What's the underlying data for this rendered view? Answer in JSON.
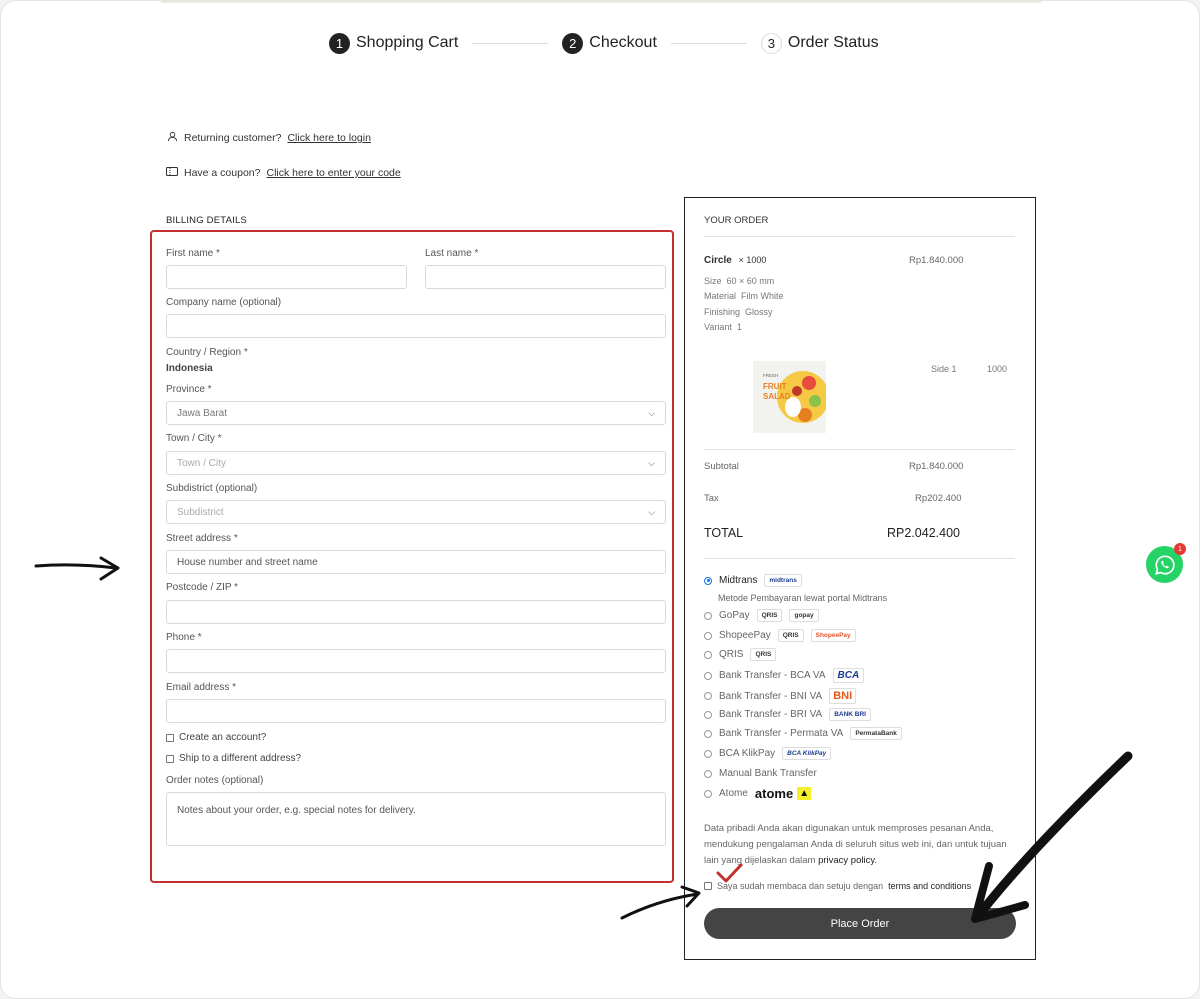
{
  "steps": [
    {
      "num": "1",
      "label": "Shopping Cart"
    },
    {
      "num": "2",
      "label": "Checkout"
    },
    {
      "num": "3",
      "label": "Order Status"
    }
  ],
  "notices": {
    "returning_text": "Returning customer?",
    "returning_link": "Click here to login",
    "coupon_text": "Have a coupon?",
    "coupon_link": "Click here to enter your code"
  },
  "billing": {
    "title": "BILLING DETAILS",
    "first_name_label": "First name *",
    "last_name_label": "Last name *",
    "company_label": "Company name (optional)",
    "country_label": "Country / Region *",
    "country_value": "Indonesia",
    "province_label": "Province *",
    "province_value": "Jawa Barat",
    "city_label": "Town / City *",
    "city_placeholder": "Town / City",
    "subdistrict_label": "Subdistrict (optional)",
    "subdistrict_placeholder": "Subdistrict",
    "street_label": "Street address *",
    "street_placeholder": "House number and street name",
    "postcode_label": "Postcode / ZIP *",
    "phone_label": "Phone *",
    "email_label": "Email address *",
    "create_account_label": "Create an account?",
    "ship_different_label": "Ship to a different address?",
    "notes_label": "Order notes (optional)",
    "notes_placeholder": "Notes about your order, e.g. special notes for delivery."
  },
  "order": {
    "title": "YOUR ORDER",
    "product_name": "Circle",
    "product_qty": "× 1000",
    "product_price": "Rp1.840.000",
    "meta": [
      {
        "key": "Size",
        "value": "60 × 60 mm"
      },
      {
        "key": "Material",
        "value": "Film White"
      },
      {
        "key": "Finishing",
        "value": "Glossy"
      },
      {
        "key": "Variant",
        "value": "1"
      }
    ],
    "side_label": "Side 1",
    "side_qty": "1000",
    "thumb_text_1": "FRESH",
    "thumb_text_2": "FRUIT",
    "thumb_text_3": "SALAD",
    "subtotal_label": "Subtotal",
    "subtotal_value": "Rp1.840.000",
    "tax_label": "Tax",
    "tax_value": "Rp202.400",
    "total_label": "TOTAL",
    "total_value": "RP2.042.400"
  },
  "payments": {
    "midtrans": "Midtrans",
    "midtrans_badge": "midtrans",
    "midtrans_desc": "Metode Pembayaran lewat portal Midtrans",
    "gopay": "GoPay",
    "gopay_badge": "gopay",
    "shopeepay": "ShopeePay",
    "shopeepay_badge": "ShopeePay",
    "qris": "QRIS",
    "qris_badge": "QRIS",
    "bca_va": "Bank Transfer - BCA VA",
    "bca_badge": "BCA",
    "bni_va": "Bank Transfer - BNI VA",
    "bni_badge": "BNI",
    "bri_va": "Bank Transfer - BRI VA",
    "bri_badge": "BANK BRI",
    "permata_va": "Bank Transfer - Permata VA",
    "permata_badge": "PermataBank",
    "klikpay": "BCA KlikPay",
    "klikpay_badge": "BCA KlikPay",
    "manual": "Manual Bank Transfer",
    "atome": "Atome",
    "atome_logo": "atome"
  },
  "privacy": {
    "text": "Data pribadi Anda akan digunakan untuk memproses pesanan Anda, mendukung pengalaman Anda di seluruh situs web ini, dan untuk tujuan lain yang dijelaskan dalam",
    "link": "privacy policy."
  },
  "terms": {
    "text": "Saya sudah membaca dan setuju dengan",
    "link": "terms and conditions"
  },
  "place_order": "Place Order",
  "whatsapp_count": "1",
  "colors": {
    "highlight_border": "#c22f2f",
    "button": "#444444",
    "whatsapp": "#25d366",
    "radio_active": "#1a73e8"
  }
}
